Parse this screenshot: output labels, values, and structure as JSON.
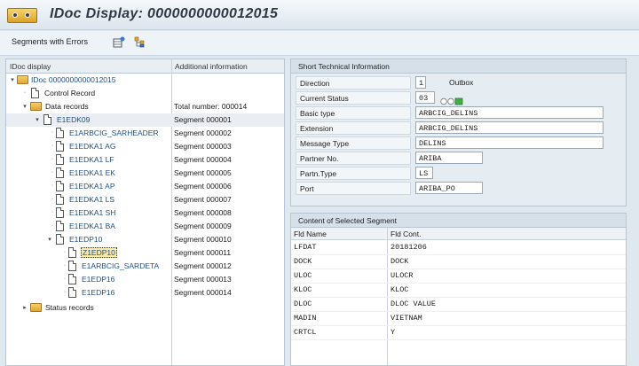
{
  "window": {
    "title": "IDoc Display: 0000000000012015"
  },
  "toolbar": {
    "segments_with_errors": "Segments with Errors",
    "icon1": "grid-settings-icon",
    "icon2": "filter-tree-icon"
  },
  "tree": {
    "header_col1": "IDoc display",
    "header_col2": "Additional information",
    "root": "IDoc 0000000000012015",
    "control_record": "Control Record",
    "data_records": "Data records",
    "data_records_info": "Total number: 000014",
    "e1edk09": "E1EDK09",
    "e1edk09_info": "Segment 000001",
    "segments": [
      {
        "name": "E1ARBCIG_SARHEADER",
        "info": "Segment 000002"
      },
      {
        "name": "E1EDKA1 AG",
        "info": "Segment 000003"
      },
      {
        "name": "E1EDKA1 LF",
        "info": "Segment 000004"
      },
      {
        "name": "E1EDKA1 EK",
        "info": "Segment 000005"
      },
      {
        "name": "E1EDKA1 AP",
        "info": "Segment 000006"
      },
      {
        "name": "E1EDKA1 LS",
        "info": "Segment 000007"
      },
      {
        "name": "E1EDKA1 SH",
        "info": "Segment 000008"
      },
      {
        "name": "E1EDKA1 BA",
        "info": "Segment 000009"
      }
    ],
    "e1edp10": "E1EDP10",
    "e1edp10_info": "Segment 000010",
    "sub_segments": [
      {
        "name": "Z1EDP10",
        "info": "Segment 000011"
      },
      {
        "name": "E1ARBCIG_SARDETA",
        "info": "Segment 000012"
      },
      {
        "name": "E1EDP16",
        "info": "Segment 000013"
      },
      {
        "name": "E1EDP16",
        "info": "Segment 000014"
      }
    ],
    "status_records": "Status records"
  },
  "tech_info": {
    "title": "Short Technical Information",
    "direction_label": "Direction",
    "direction_value": "1",
    "direction_text": "Outbox",
    "status_label": "Current Status",
    "status_value": "03",
    "basic_type_label": "Basic type",
    "basic_type_value": "ARBCIG_DELINS",
    "extension_label": "Extension",
    "extension_value": "ARBCIG_DELINS",
    "message_type_label": "Message Type",
    "message_type_value": "DELINS",
    "partner_no_label": "Partner No.",
    "partner_no_value": "ARIBA",
    "partn_type_label": "Partn.Type",
    "partn_type_value": "LS",
    "port_label": "Port",
    "port_value": "ARIBA_PO"
  },
  "segment_content": {
    "title": "Content of Selected Segment",
    "col_name": "Fld Name",
    "col_cont": "Fld Cont.",
    "rows": [
      {
        "name": "LFDAT",
        "value": "20181206"
      },
      {
        "name": "DOCK",
        "value": "DOCK"
      },
      {
        "name": "ULOC",
        "value": "ULOCR"
      },
      {
        "name": "KLOC",
        "value": "KLOC"
      },
      {
        "name": "DLOC",
        "value": "DLOC VALUE"
      },
      {
        "name": "MADIN",
        "value": "VIETNAM"
      },
      {
        "name": "CRTCL",
        "value": "Y"
      }
    ]
  },
  "colors": {
    "accent_blue": "#1e4f8a",
    "status_green": "#3cb043"
  }
}
